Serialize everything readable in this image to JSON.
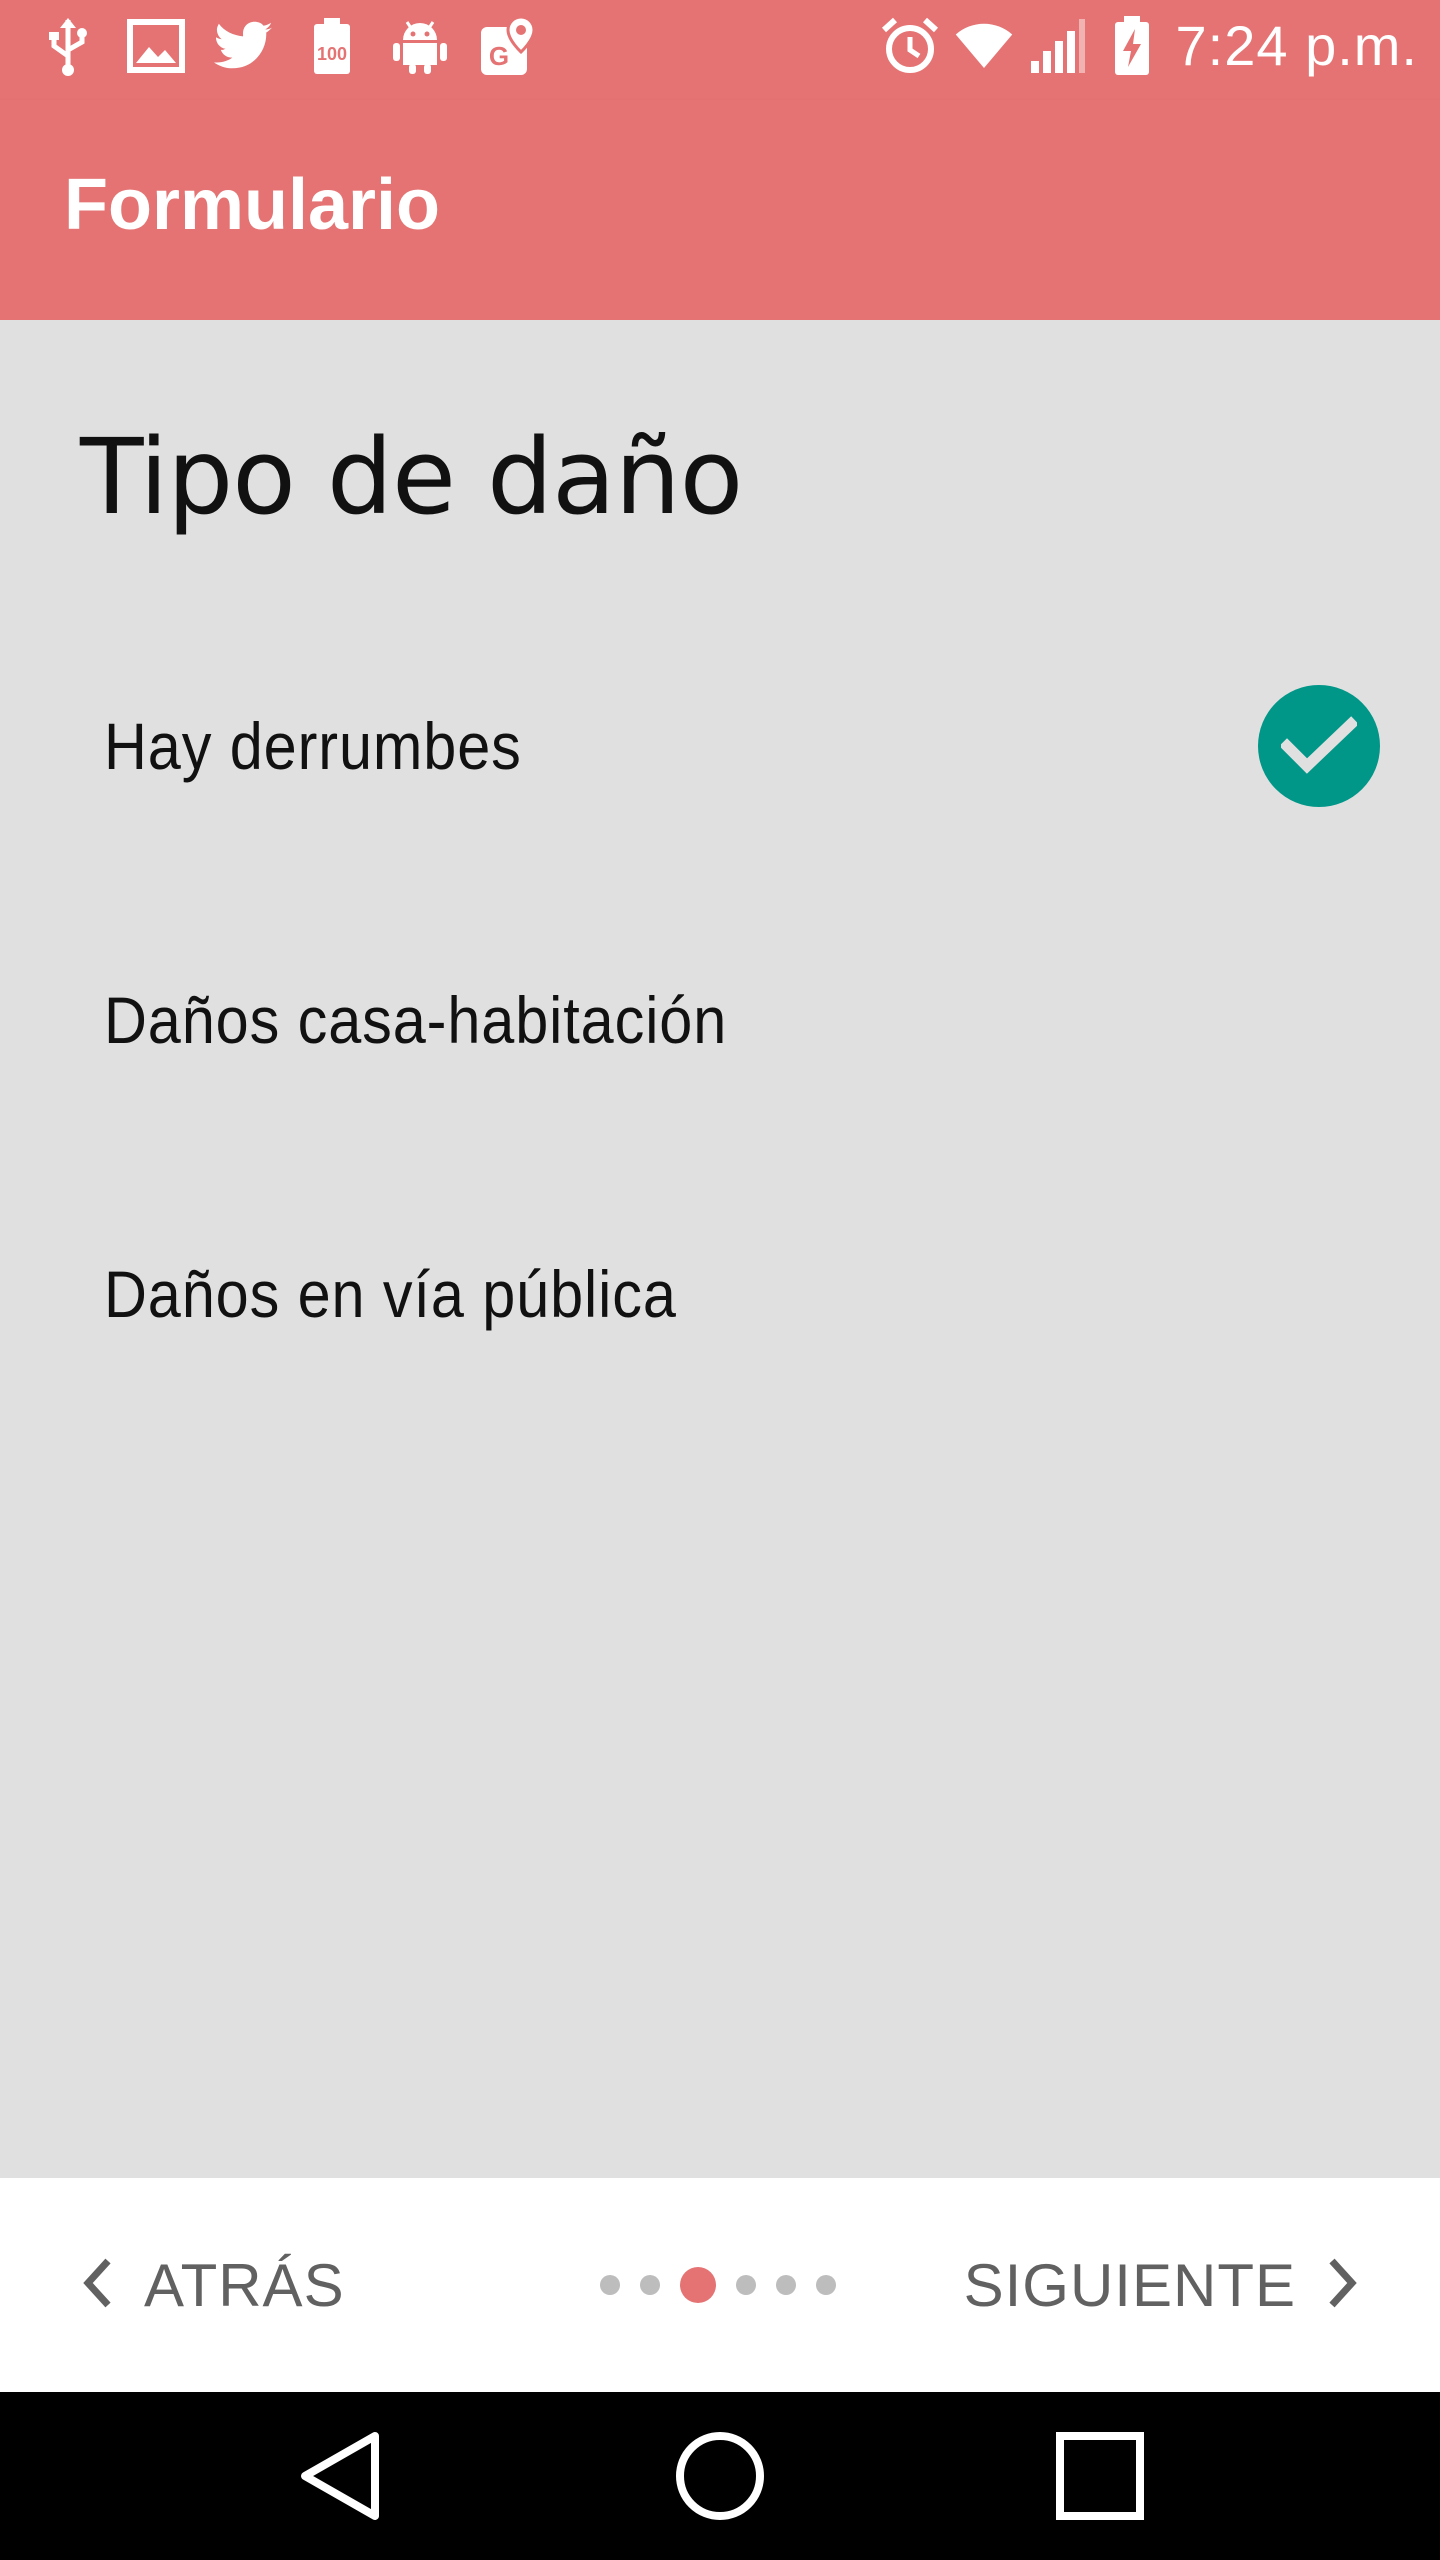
{
  "status_bar": {
    "time": "7:24 p.m.",
    "left_icons": [
      "usb-icon",
      "gallery-icon",
      "twitter-icon",
      "battery-100-icon",
      "android-icon",
      "maps-icon"
    ],
    "right_icons": [
      "alarm-icon",
      "wifi-icon",
      "signal-icon",
      "battery-charging-icon"
    ]
  },
  "app_bar": {
    "title": "Formulario"
  },
  "form": {
    "section_title": "Tipo de daño",
    "options": [
      {
        "label": "Hay derrumbes",
        "checked": true
      },
      {
        "label": "Daños casa-habitación",
        "checked": false
      },
      {
        "label": "Daños en vía pública",
        "checked": false
      }
    ]
  },
  "bottom_nav": {
    "back_label": "ATRÁS",
    "next_label": "SIGUIENTE",
    "page_count": 6,
    "current_page": 3
  },
  "colors": {
    "accent": "#e57373",
    "check": "#009688",
    "background": "#e0e0e0"
  }
}
